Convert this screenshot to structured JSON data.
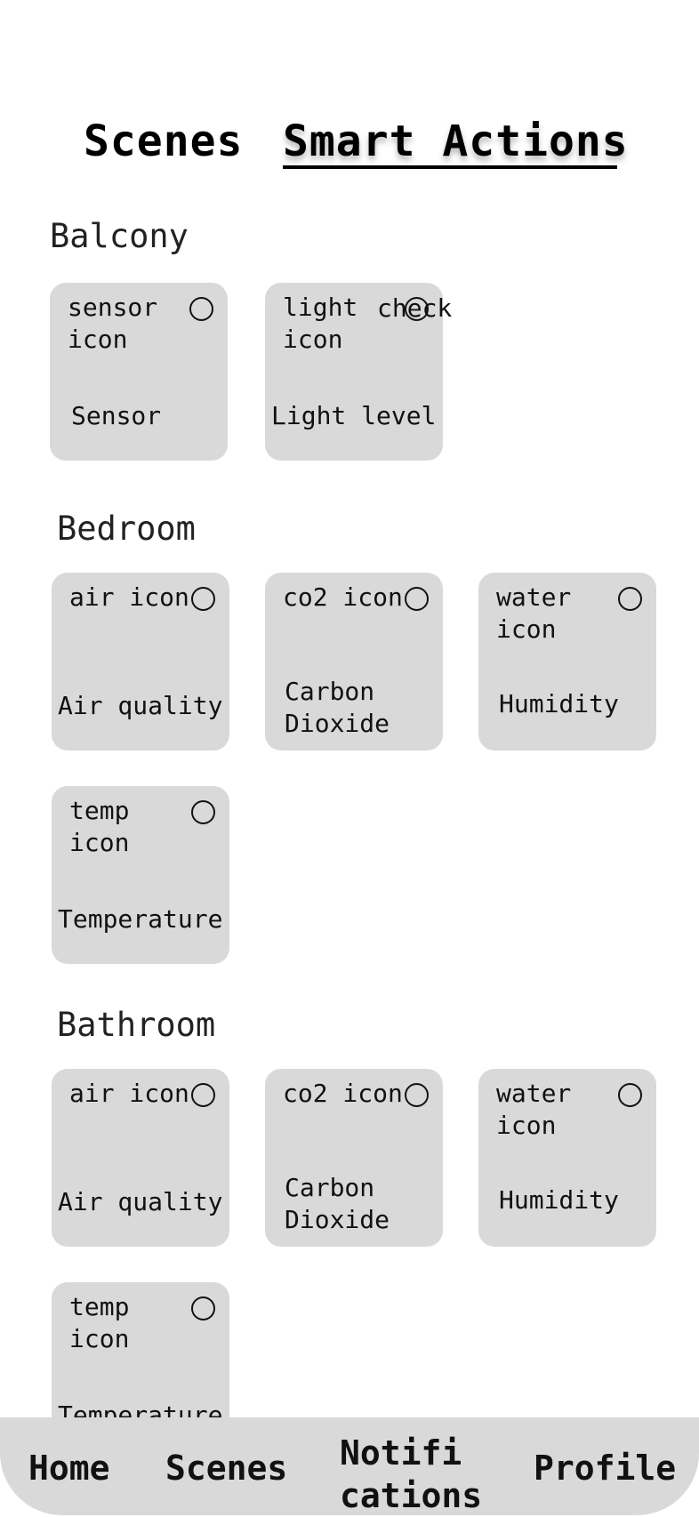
{
  "tabs": {
    "scenes": "Scenes",
    "smart_actions": "Smart Actions"
  },
  "sections": {
    "balcony": {
      "title": "Balcony",
      "cards": [
        {
          "icon": "sensor icon",
          "label": "Sensor"
        },
        {
          "icon": "light icon",
          "label": "Light level",
          "check_text": "check"
        }
      ]
    },
    "bedroom": {
      "title": "Bedroom",
      "cards": [
        {
          "icon": "air icon",
          "label": "Air quality"
        },
        {
          "icon": "co2 icon",
          "label": "Carbon Dioxide"
        },
        {
          "icon": "water icon",
          "label": "Humidity"
        },
        {
          "icon": "temp icon",
          "label": "Temperature"
        }
      ]
    },
    "bathroom": {
      "title": "Bathroom",
      "cards": [
        {
          "icon": "air icon",
          "label": "Air quality"
        },
        {
          "icon": "co2 icon",
          "label": "Carbon Dioxide"
        },
        {
          "icon": "water icon",
          "label": "Humidity"
        },
        {
          "icon": "temp icon",
          "label": "Temperature"
        }
      ]
    }
  },
  "bottom_nav": {
    "home": "Home",
    "scenes": "Scenes",
    "notifications": "Notifi cations",
    "profile": "Profile"
  }
}
